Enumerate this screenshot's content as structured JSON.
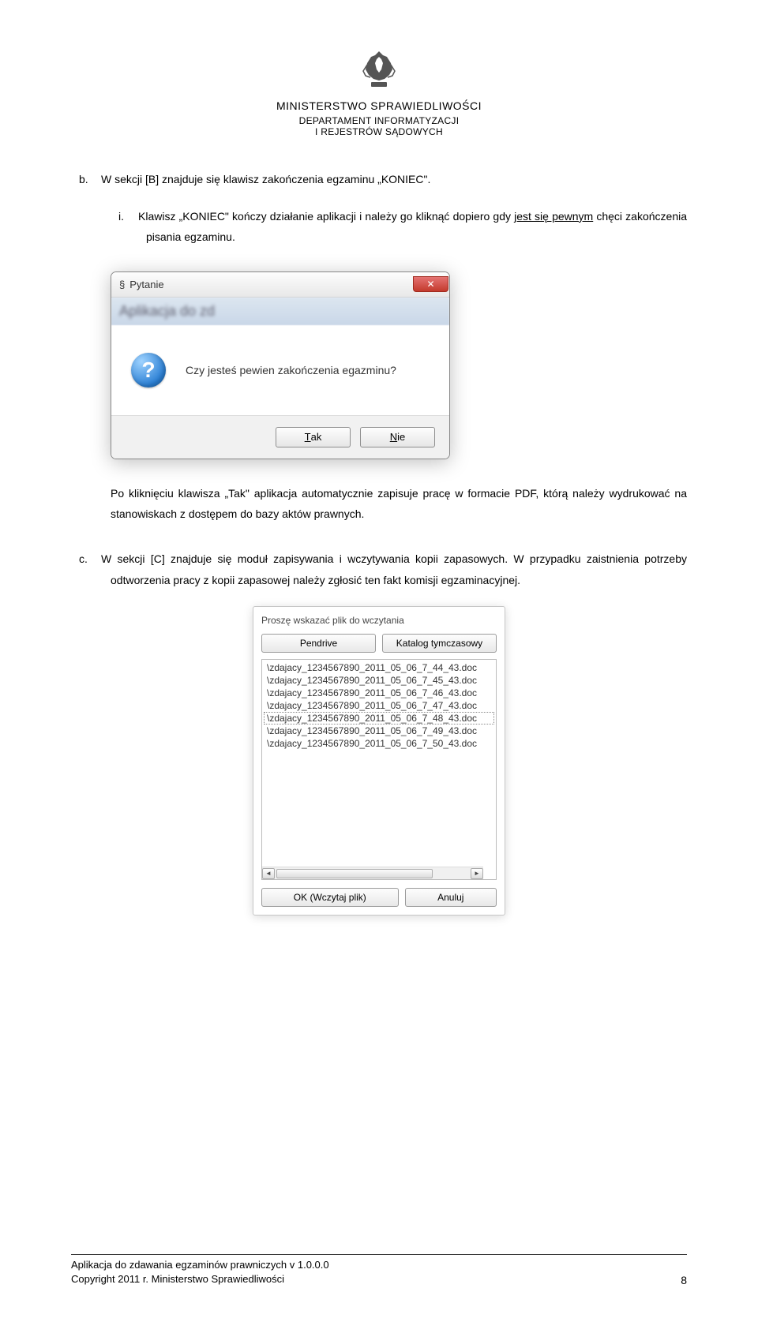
{
  "header": {
    "ministry": "MINISTERSTWO SPRAWIEDLIWOŚCI",
    "dept_line1": "DEPARTAMENT INFORMATYZACJI",
    "dept_line2": "I REJESTRÓW SĄDOWYCH"
  },
  "body": {
    "item_b_marker": "b.",
    "item_b_text": "W sekcji [B] znajduje się klawisz zakończenia egzaminu „KONIEC\".",
    "item_b_sub_marker": "i.",
    "item_b_sub_prefix": "Klawisz „KONIEC\" kończy działanie aplikacji i należy go kliknąć dopiero gdy ",
    "item_b_sub_underlined": "jest się pewnym",
    "item_b_sub_suffix": " chęci zakończenia pisania egzaminu.",
    "after_dialog": "Po kliknięciu klawisza „Tak\" aplikacja automatycznie zapisuje pracę w formacie PDF, którą należy wydrukować na stanowiskach z dostępem do bazy aktów prawnych.",
    "item_c_marker": "c.",
    "item_c_line1": "W sekcji [C] znajduje się moduł zapisywania i wczytywania kopii zapasowych.",
    "item_c_line2": "W przypadku zaistnienia potrzeby odtworzenia pracy z kopii zapasowej należy zgłosić ten fakt komisji egzaminacyjnej."
  },
  "dialog1": {
    "title_symbol": "§",
    "title": "Pytanie",
    "backdrop_hint": "Aplikacja do zd",
    "question": "Czy jesteś pewien zakończenia egazminu?",
    "yes_prefix": "T",
    "yes_rest": "ak",
    "no_prefix": "N",
    "no_rest": "ie"
  },
  "dialog2": {
    "title": "Proszę wskazać plik do wczytania",
    "btn_pendrive": "Pendrive",
    "btn_tmp": "Katalog tymczasowy",
    "files": [
      "\\zdajacy_1234567890_2011_05_06_7_44_43.doc",
      "\\zdajacy_1234567890_2011_05_06_7_45_43.doc",
      "\\zdajacy_1234567890_2011_05_06_7_46_43.doc",
      "\\zdajacy_1234567890_2011_05_06_7_47_43.doc",
      "\\zdajacy_1234567890_2011_05_06_7_48_43.doc",
      "\\zdajacy_1234567890_2011_05_06_7_49_43.doc",
      "\\zdajacy_1234567890_2011_05_06_7_50_43.doc"
    ],
    "selected_index": 4,
    "btn_ok": "OK (Wczytaj plik)",
    "btn_cancel": "Anuluj"
  },
  "footer": {
    "line1": "Aplikacja do zdawania egzaminów prawniczych v 1.0.0.0",
    "line2": "Copyright 2011 r. Ministerstwo Sprawiedliwości",
    "page": "8"
  }
}
